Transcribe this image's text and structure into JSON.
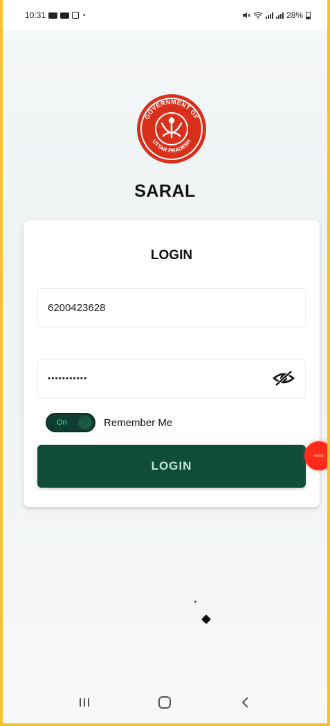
{
  "status_bar": {
    "time": "10:31",
    "battery": "28%"
  },
  "app": {
    "title": "SARAL",
    "logo": {
      "top_text": "GOVERNMENT OF",
      "bottom_text": "UTTAR PRADESH",
      "color": "#d9301c"
    }
  },
  "login_card": {
    "title": "LOGIN",
    "phone_value": "6200423628",
    "password_value": "•••••••••••",
    "remember_toggle": {
      "label": "On",
      "checked": true
    },
    "remember_label": "Remember Me",
    "submit_label": "LOGIN"
  },
  "colors": {
    "primary": "#0f4c3a",
    "accent_toggle_text": "#5ee08d",
    "touch_indicator": "#ff2a1a"
  },
  "icons": {
    "password_visibility": "eye-off-icon",
    "nav_recents": "recents-icon",
    "nav_home": "home-icon",
    "nav_back": "back-icon"
  }
}
